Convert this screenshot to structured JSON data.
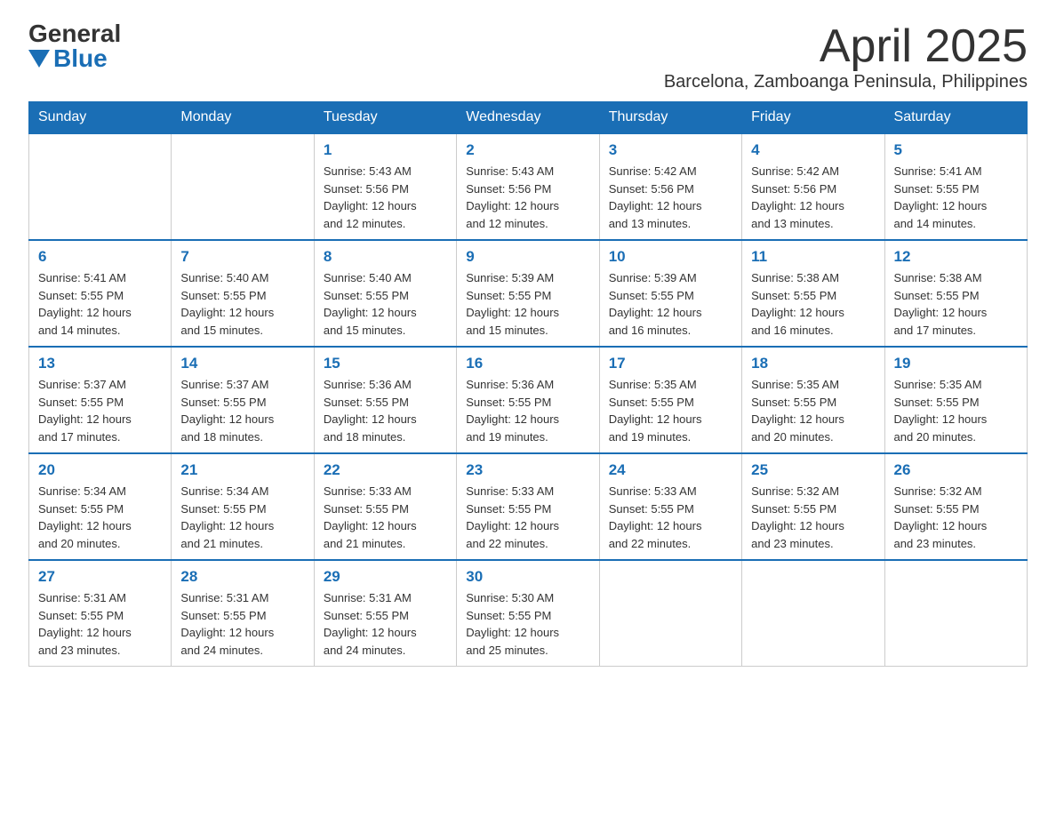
{
  "header": {
    "logo_general": "General",
    "logo_blue": "Blue",
    "month_title": "April 2025",
    "location": "Barcelona, Zamboanga Peninsula, Philippines"
  },
  "days_of_week": [
    "Sunday",
    "Monday",
    "Tuesday",
    "Wednesday",
    "Thursday",
    "Friday",
    "Saturday"
  ],
  "weeks": [
    [
      null,
      null,
      {
        "day": "1",
        "sunrise": "5:43 AM",
        "sunset": "5:56 PM",
        "daylight": "12 hours and 12 minutes."
      },
      {
        "day": "2",
        "sunrise": "5:43 AM",
        "sunset": "5:56 PM",
        "daylight": "12 hours and 12 minutes."
      },
      {
        "day": "3",
        "sunrise": "5:42 AM",
        "sunset": "5:56 PM",
        "daylight": "12 hours and 13 minutes."
      },
      {
        "day": "4",
        "sunrise": "5:42 AM",
        "sunset": "5:56 PM",
        "daylight": "12 hours and 13 minutes."
      },
      {
        "day": "5",
        "sunrise": "5:41 AM",
        "sunset": "5:55 PM",
        "daylight": "12 hours and 14 minutes."
      }
    ],
    [
      {
        "day": "6",
        "sunrise": "5:41 AM",
        "sunset": "5:55 PM",
        "daylight": "12 hours and 14 minutes."
      },
      {
        "day": "7",
        "sunrise": "5:40 AM",
        "sunset": "5:55 PM",
        "daylight": "12 hours and 15 minutes."
      },
      {
        "day": "8",
        "sunrise": "5:40 AM",
        "sunset": "5:55 PM",
        "daylight": "12 hours and 15 minutes."
      },
      {
        "day": "9",
        "sunrise": "5:39 AM",
        "sunset": "5:55 PM",
        "daylight": "12 hours and 15 minutes."
      },
      {
        "day": "10",
        "sunrise": "5:39 AM",
        "sunset": "5:55 PM",
        "daylight": "12 hours and 16 minutes."
      },
      {
        "day": "11",
        "sunrise": "5:38 AM",
        "sunset": "5:55 PM",
        "daylight": "12 hours and 16 minutes."
      },
      {
        "day": "12",
        "sunrise": "5:38 AM",
        "sunset": "5:55 PM",
        "daylight": "12 hours and 17 minutes."
      }
    ],
    [
      {
        "day": "13",
        "sunrise": "5:37 AM",
        "sunset": "5:55 PM",
        "daylight": "12 hours and 17 minutes."
      },
      {
        "day": "14",
        "sunrise": "5:37 AM",
        "sunset": "5:55 PM",
        "daylight": "12 hours and 18 minutes."
      },
      {
        "day": "15",
        "sunrise": "5:36 AM",
        "sunset": "5:55 PM",
        "daylight": "12 hours and 18 minutes."
      },
      {
        "day": "16",
        "sunrise": "5:36 AM",
        "sunset": "5:55 PM",
        "daylight": "12 hours and 19 minutes."
      },
      {
        "day": "17",
        "sunrise": "5:35 AM",
        "sunset": "5:55 PM",
        "daylight": "12 hours and 19 minutes."
      },
      {
        "day": "18",
        "sunrise": "5:35 AM",
        "sunset": "5:55 PM",
        "daylight": "12 hours and 20 minutes."
      },
      {
        "day": "19",
        "sunrise": "5:35 AM",
        "sunset": "5:55 PM",
        "daylight": "12 hours and 20 minutes."
      }
    ],
    [
      {
        "day": "20",
        "sunrise": "5:34 AM",
        "sunset": "5:55 PM",
        "daylight": "12 hours and 20 minutes."
      },
      {
        "day": "21",
        "sunrise": "5:34 AM",
        "sunset": "5:55 PM",
        "daylight": "12 hours and 21 minutes."
      },
      {
        "day": "22",
        "sunrise": "5:33 AM",
        "sunset": "5:55 PM",
        "daylight": "12 hours and 21 minutes."
      },
      {
        "day": "23",
        "sunrise": "5:33 AM",
        "sunset": "5:55 PM",
        "daylight": "12 hours and 22 minutes."
      },
      {
        "day": "24",
        "sunrise": "5:33 AM",
        "sunset": "5:55 PM",
        "daylight": "12 hours and 22 minutes."
      },
      {
        "day": "25",
        "sunrise": "5:32 AM",
        "sunset": "5:55 PM",
        "daylight": "12 hours and 23 minutes."
      },
      {
        "day": "26",
        "sunrise": "5:32 AM",
        "sunset": "5:55 PM",
        "daylight": "12 hours and 23 minutes."
      }
    ],
    [
      {
        "day": "27",
        "sunrise": "5:31 AM",
        "sunset": "5:55 PM",
        "daylight": "12 hours and 23 minutes."
      },
      {
        "day": "28",
        "sunrise": "5:31 AM",
        "sunset": "5:55 PM",
        "daylight": "12 hours and 24 minutes."
      },
      {
        "day": "29",
        "sunrise": "5:31 AM",
        "sunset": "5:55 PM",
        "daylight": "12 hours and 24 minutes."
      },
      {
        "day": "30",
        "sunrise": "5:30 AM",
        "sunset": "5:55 PM",
        "daylight": "12 hours and 25 minutes."
      },
      null,
      null,
      null
    ]
  ],
  "labels": {
    "sunrise": "Sunrise:",
    "sunset": "Sunset:",
    "daylight": "Daylight:"
  }
}
